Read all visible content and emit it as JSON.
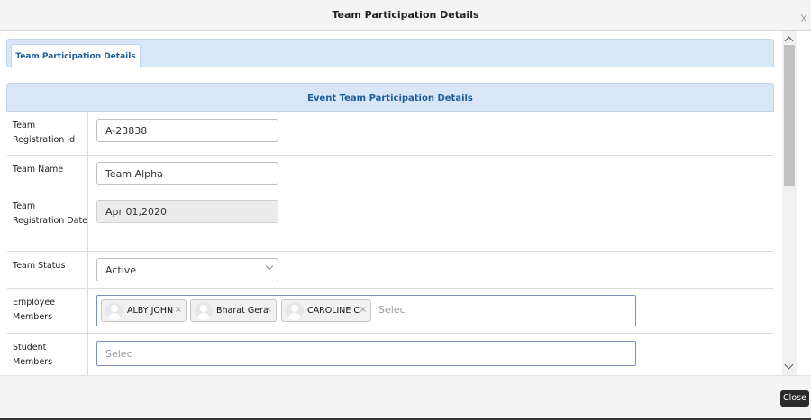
{
  "dialog": {
    "title": "Team Participation Details",
    "close_x": "X",
    "close_button": "Close"
  },
  "tabs": [
    {
      "label": "Team Participation Details",
      "active": true
    }
  ],
  "section": {
    "header": "Event Team Participation Details"
  },
  "form": {
    "team_registration_id": {
      "label": "Team Registration Id",
      "value": "A-23838"
    },
    "team_name": {
      "label": "Team Name",
      "value": "Team Alpha"
    },
    "team_registration_date": {
      "label": "Team Registration Date",
      "value": "Apr 01,2020",
      "disabled": true
    },
    "team_status": {
      "label": "Team Status",
      "value": "Active"
    },
    "employee_members": {
      "label": "Employee Members",
      "chips": [
        "ALBY JOHN",
        "Bharat Gera",
        "CAROLINE C"
      ],
      "placeholder": "Selec"
    },
    "student_members": {
      "label": "Student Members",
      "placeholder": "Selec"
    }
  },
  "icons": {
    "chip_remove": "×",
    "avatar": "user-avatar-icon",
    "dropdown": "chevron-down-icon"
  },
  "colors": {
    "accent": "#1f5d9a",
    "section_bg": "#d9e6f7",
    "button_bg": "#2b2b2b"
  }
}
